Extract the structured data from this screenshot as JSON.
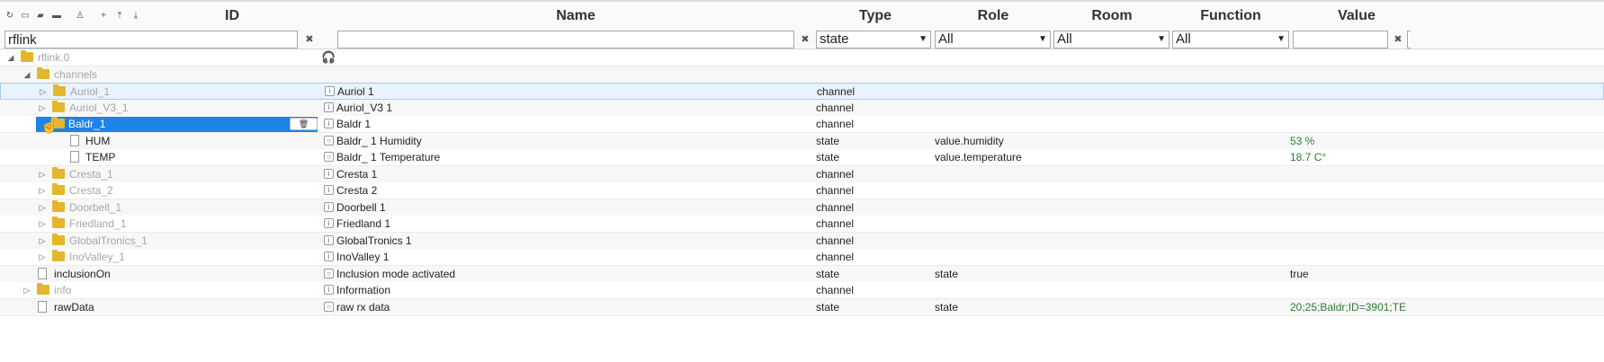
{
  "toolbar": {
    "icons": [
      "refresh-icon",
      "collapse-icon",
      "folder-open-icon",
      "folder-icon",
      "user-icon",
      "add-icon",
      "upload-icon",
      "download-icon"
    ]
  },
  "columns": {
    "id": "ID",
    "name": "Name",
    "type": "Type",
    "role": "Role",
    "room": "Room",
    "function": "Function",
    "value": "Value"
  },
  "filters": {
    "id_value": "rflink",
    "name_value": "",
    "type_value": "state",
    "role_value": "All",
    "room_value": "All",
    "function_value": "All",
    "value_value": "",
    "clear": "✖",
    "arrow": "▼"
  },
  "tree": {
    "root": {
      "id": "rflink.0"
    },
    "channels": {
      "id": "channels"
    },
    "rows": [
      {
        "id": "Auriol_1",
        "name": "Auriol 1",
        "type": "channel",
        "role": "",
        "value": ""
      },
      {
        "id": "Auriol_V3_1",
        "name": "Auriol_V3 1",
        "type": "channel",
        "role": "",
        "value": ""
      },
      {
        "id": "Baldr_1",
        "name": "Baldr 1",
        "type": "channel",
        "role": "",
        "value": ""
      },
      {
        "id": "HUM",
        "name": "Baldr_ 1 Humidity",
        "type": "state",
        "role": "value.humidity",
        "value": "53 %"
      },
      {
        "id": "TEMP",
        "name": "Baldr_ 1 Temperature",
        "type": "state",
        "role": "value.temperature",
        "value": "18.7 C°"
      },
      {
        "id": "Cresta_1",
        "name": "Cresta 1",
        "type": "channel",
        "role": "",
        "value": ""
      },
      {
        "id": "Cresta_2",
        "name": "Cresta 2",
        "type": "channel",
        "role": "",
        "value": ""
      },
      {
        "id": "Doorbell_1",
        "name": "Doorbell 1",
        "type": "channel",
        "role": "",
        "value": ""
      },
      {
        "id": "Friedland_1",
        "name": "Friedland 1",
        "type": "channel",
        "role": "",
        "value": ""
      },
      {
        "id": "GlobalTronics_1",
        "name": "GlobalTronics 1",
        "type": "channel",
        "role": "",
        "value": ""
      },
      {
        "id": "InoValley_1",
        "name": "InoValley 1",
        "type": "channel",
        "role": "",
        "value": ""
      },
      {
        "id": "inclusionOn",
        "name": "Inclusion mode activated",
        "type": "state",
        "role": "state",
        "value": "true"
      },
      {
        "id": "info",
        "name": "Information",
        "type": "channel",
        "role": "",
        "value": ""
      },
      {
        "id": "rawData",
        "name": "raw rx data",
        "type": "state",
        "role": "state",
        "value": "20;25;Baldr;ID=3901;TE"
      }
    ]
  },
  "colors": {
    "selection": "#1e83e6",
    "folder": "#e4b62b",
    "value_text": "#2e7d32"
  }
}
